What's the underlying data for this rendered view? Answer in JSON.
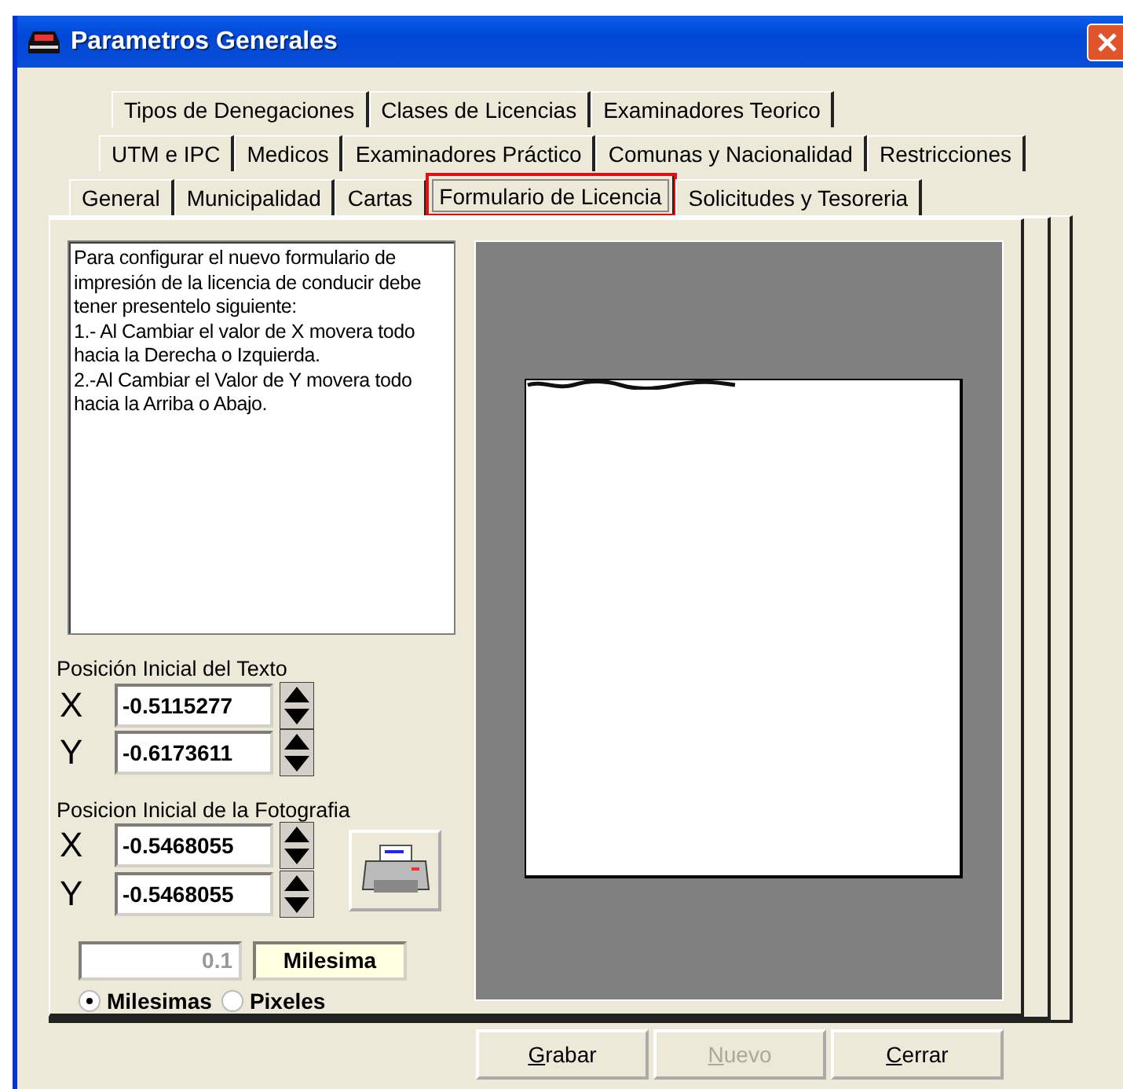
{
  "window": {
    "title": "Parametros Generales"
  },
  "tab_rows": [
    {
      "tabs": [
        {
          "label": "Tipos de Denegaciones",
          "selected": false,
          "highlighted": false
        },
        {
          "label": "Clases de Licencias",
          "selected": false,
          "highlighted": false
        },
        {
          "label": "Examinadores Teorico",
          "selected": false,
          "highlighted": false
        }
      ]
    },
    {
      "tabs": [
        {
          "label": "UTM e IPC",
          "selected": false,
          "highlighted": false
        },
        {
          "label": "Medicos",
          "selected": false,
          "highlighted": false
        },
        {
          "label": "Examinadores Práctico",
          "selected": false,
          "highlighted": false
        },
        {
          "label": "Comunas y Nacionalidad",
          "selected": false,
          "highlighted": false
        },
        {
          "label": "Restricciones",
          "selected": false,
          "highlighted": false
        }
      ]
    },
    {
      "tabs": [
        {
          "label": "General",
          "selected": false,
          "highlighted": false
        },
        {
          "label": "Municipalidad",
          "selected": false,
          "highlighted": false
        },
        {
          "label": "Cartas",
          "selected": false,
          "highlighted": false
        },
        {
          "label": "Formulario de Licencia",
          "selected": true,
          "highlighted": true
        },
        {
          "label": "Solicitudes y Tesoreria",
          "selected": false,
          "highlighted": false
        }
      ]
    }
  ],
  "instructions": [
    "Para configurar el nuevo formulario de impresión de la licencia de conducir debe tener presentelo siguiente:",
    "1.- Al Cambiar el valor de X movera todo hacia la Derecha o Izquierda.",
    "2.-Al Cambiar el Valor de Y movera todo hacia la Arriba o Abajo."
  ],
  "text_position": {
    "label": "Posición Inicial del Texto",
    "fields": [
      {
        "axis": "X",
        "value": "-0.5115277"
      },
      {
        "axis": "Y",
        "value": "-0.6173611"
      }
    ]
  },
  "photo_position": {
    "label": "Posicion Inicial de la Fotografia",
    "fields": [
      {
        "axis": "X",
        "value": "-0.5468055"
      },
      {
        "axis": "Y",
        "value": "-0.5468055"
      }
    ]
  },
  "step": {
    "value": "0.1",
    "disabled": true
  },
  "unit_label": "Milesima",
  "units": [
    {
      "label": "Milesimas",
      "selected": true
    },
    {
      "label": "Pixeles",
      "selected": false
    }
  ],
  "buttons": [
    {
      "label": "Grabar",
      "disabled": false
    },
    {
      "label": "Nuevo",
      "disabled": true
    },
    {
      "label": "Cerrar",
      "disabled": false
    }
  ]
}
